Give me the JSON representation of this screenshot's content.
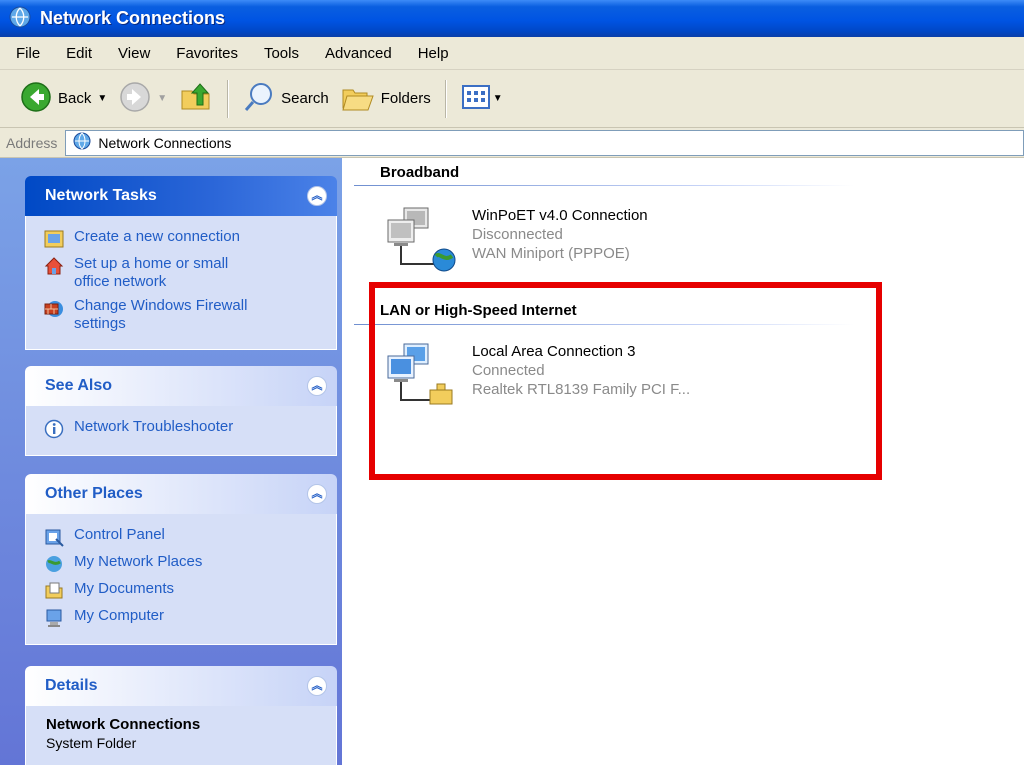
{
  "window": {
    "title": "Network Connections"
  },
  "menu": [
    "File",
    "Edit",
    "View",
    "Favorites",
    "Tools",
    "Advanced",
    "Help"
  ],
  "toolbar": {
    "back": "Back",
    "search": "Search",
    "folders": "Folders"
  },
  "address": {
    "label": "Address",
    "value": "Network Connections"
  },
  "sidebar": {
    "network_tasks": {
      "title": "Network Tasks",
      "items": [
        {
          "label": "Create a new connection",
          "icon": "new-connection-icon"
        },
        {
          "label": "Set up a home or small office network",
          "icon": "home-network-icon"
        },
        {
          "label": "Change Windows Firewall settings",
          "icon": "firewall-icon"
        }
      ]
    },
    "see_also": {
      "title": "See Also",
      "items": [
        {
          "label": "Network Troubleshooter",
          "icon": "info-icon"
        }
      ]
    },
    "other_places": {
      "title": "Other Places",
      "items": [
        {
          "label": "Control Panel",
          "icon": "control-panel-icon"
        },
        {
          "label": "My Network Places",
          "icon": "network-places-icon"
        },
        {
          "label": "My Documents",
          "icon": "documents-icon"
        },
        {
          "label": "My Computer",
          "icon": "computer-icon"
        }
      ]
    },
    "details": {
      "title": "Details",
      "name": "Network Connections",
      "type": "System Folder"
    }
  },
  "groups": [
    {
      "title": "Broadband",
      "connection": {
        "name": "WinPoET v4.0 Connection",
        "status": "Disconnected",
        "device": "WAN Miniport (PPPOE)"
      }
    },
    {
      "title": "LAN or High-Speed Internet",
      "connection": {
        "name": "Local Area Connection 3",
        "status": "Connected",
        "device": "Realtek RTL8139 Family PCI F..."
      }
    }
  ],
  "colors": {
    "titlebar": "#0054e3",
    "highlight": "#e60000",
    "link": "#215dc6"
  }
}
